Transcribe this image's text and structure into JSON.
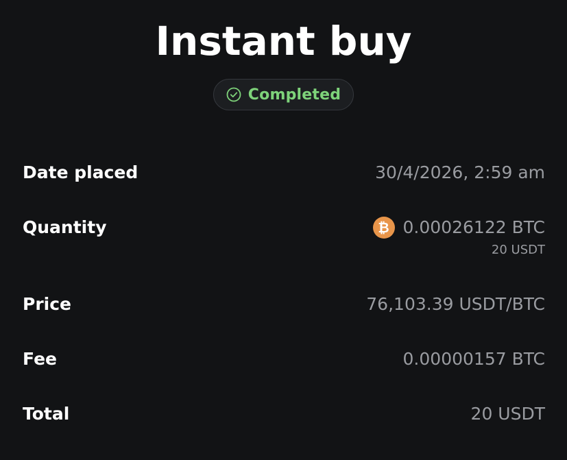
{
  "header": {
    "title": "Instant buy"
  },
  "status": {
    "label": "Completed",
    "icon": "check-circle-icon",
    "color": "#7ed37a"
  },
  "details": {
    "date_label": "Date placed",
    "date_value": "30/4/2026, 2:59 am",
    "quantity_label": "Quantity",
    "quantity_value": "0.00026122 BTC",
    "quantity_sub": "20 USDT",
    "quantity_icon": "bitcoin-icon",
    "price_label": "Price",
    "price_value": "76,103.39 USDT/BTC",
    "fee_label": "Fee",
    "fee_value": "0.00000157 BTC",
    "total_label": "Total",
    "total_value": "20 USDT"
  }
}
